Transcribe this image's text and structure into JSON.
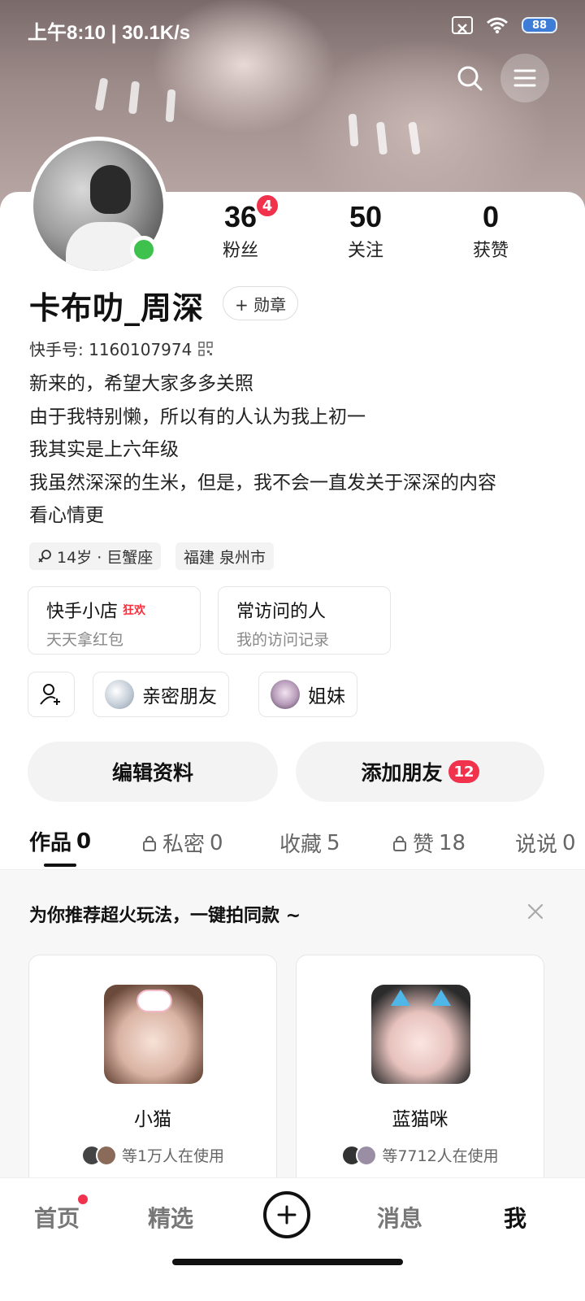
{
  "status_bar": {
    "time_speed": "上午8:10 | 30.1K/s",
    "battery": "88"
  },
  "colors": {
    "accent_red": "#f0324c",
    "online_green": "#3ec24d",
    "hot_red": "#ff2a3a"
  },
  "profile": {
    "name": "卡布叻_周深",
    "medal_label": "+ 勋章",
    "kuaishou_id": "快手号: 1160107974",
    "stats": [
      {
        "num": "36",
        "label": "粉丝",
        "badge": "4"
      },
      {
        "num": "50",
        "label": "关注"
      },
      {
        "num": "0",
        "label": "获赞"
      }
    ],
    "bio": [
      "新来的，希望大家多多关照",
      "由于我特别懒，所以有的人认为我上初一",
      "我其实是上六年级",
      "我虽然深深的生米，但是，我不会一直发关于深深的内容",
      "看心情更"
    ],
    "tags": [
      "14岁 · 巨蟹座",
      "福建 泉州市"
    ]
  },
  "shortcuts": [
    {
      "title": "快手小店",
      "hot": "狂欢",
      "sub": "天天拿红包"
    },
    {
      "title": "常访问的人",
      "sub": "我的访问记录"
    }
  ],
  "friend_chips": [
    "亲密朋友",
    "姐妹"
  ],
  "actions": {
    "edit": "编辑资料",
    "add_friend": "添加朋友",
    "add_friend_badge": "12"
  },
  "tabs": [
    {
      "label": "作品",
      "count": "0"
    },
    {
      "label": "私密",
      "count": "0"
    },
    {
      "label": "收藏",
      "count": "5"
    },
    {
      "label": "赞",
      "count": "18"
    },
    {
      "label": "说说",
      "count": "0"
    }
  ],
  "recommend": {
    "title": "为你推荐超火玩法，一键拍同款 ~",
    "cards": [
      {
        "title": "小猫",
        "usage": "等1万人在使用"
      },
      {
        "title": "蓝猫咪",
        "usage": "等7712人在使用"
      }
    ]
  },
  "bottom_nav": [
    "首页",
    "精选",
    "消息",
    "我"
  ],
  "icons": {
    "search": "search-icon",
    "menu": "menu-icon",
    "add_friend": "add-user-icon",
    "lock": "lock-icon",
    "close": "close-icon",
    "plus": "plus-icon",
    "qr": "qr-code-icon"
  }
}
